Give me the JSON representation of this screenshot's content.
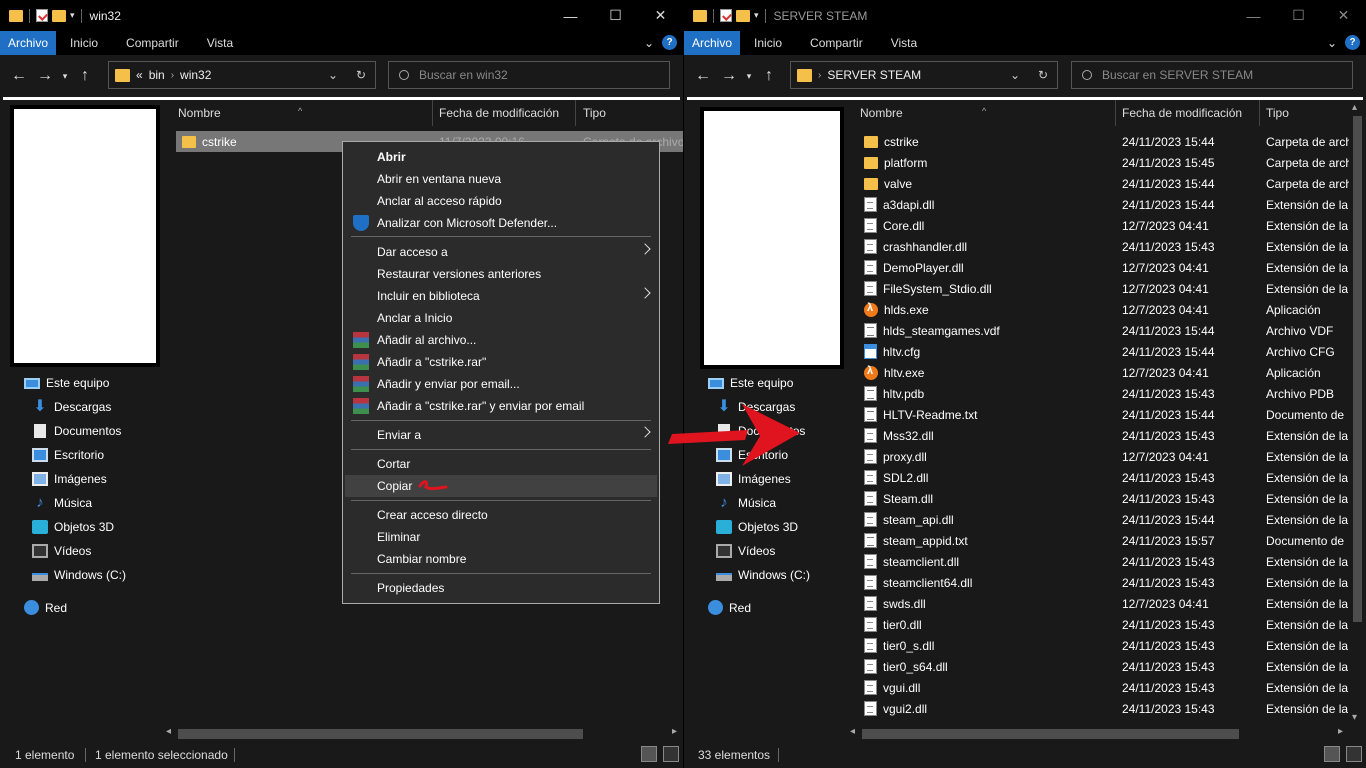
{
  "left": {
    "title": "win32",
    "ribbon_tabs": [
      "Archivo",
      "Inicio",
      "Compartir",
      "Vista"
    ],
    "breadcrumb": [
      "«",
      "bin",
      "win32"
    ],
    "search_placeholder": "Buscar en win32",
    "nav_items": [
      "Este equipo",
      "Descargas",
      "Documentos",
      "Escritorio",
      "Imágenes",
      "Música",
      "Objetos 3D",
      "Vídeos",
      "Windows (C:)",
      "Red"
    ],
    "columns": [
      "Nombre",
      "Fecha de modificación",
      "Tipo"
    ],
    "row": {
      "name": "cstrike",
      "date": "11/7/2023 00:16",
      "type": "Carpeta de archivos"
    },
    "status_count": "1 elemento",
    "status_selected": "1 elemento seleccionado"
  },
  "context_menu": {
    "items": [
      "Abrir",
      "Abrir en ventana nueva",
      "Anclar al acceso rápido",
      "Analizar con Microsoft Defender...",
      "Dar acceso a",
      "Restaurar versiones anteriores",
      "Incluir en biblioteca",
      "Anclar a Inicio",
      "Añadir al archivo...",
      "Añadir a \"cstrike.rar\"",
      "Añadir y enviar por email...",
      "Añadir a \"cstrike.rar\" y enviar por email",
      "Enviar a",
      "Cortar",
      "Copiar",
      "Crear acceso directo",
      "Eliminar",
      "Cambiar nombre",
      "Propiedades"
    ],
    "highlighted": "Copiar"
  },
  "right": {
    "title": "SERVER STEAM",
    "ribbon_tabs": [
      "Archivo",
      "Inicio",
      "Compartir",
      "Vista"
    ],
    "breadcrumb": [
      "SERVER STEAM"
    ],
    "search_placeholder": "Buscar en SERVER STEAM",
    "nav_items": [
      "Este equipo",
      "Descargas",
      "Documentos",
      "Escritorio",
      "Imágenes",
      "Música",
      "Objetos 3D",
      "Vídeos",
      "Windows (C:)",
      "Red"
    ],
    "columns": [
      "Nombre",
      "Fecha de modificación",
      "Tipo"
    ],
    "rows": [
      {
        "name": "cstrike",
        "date": "24/11/2023 15:44",
        "type": "Carpeta de arch",
        "icon": "folder"
      },
      {
        "name": "platform",
        "date": "24/11/2023 15:45",
        "type": "Carpeta de arch",
        "icon": "folder"
      },
      {
        "name": "valve",
        "date": "24/11/2023 15:44",
        "type": "Carpeta de arch",
        "icon": "folder"
      },
      {
        "name": "a3dapi.dll",
        "date": "24/11/2023 15:44",
        "type": "Extensión de la",
        "icon": "dll"
      },
      {
        "name": "Core.dll",
        "date": "12/7/2023 04:41",
        "type": "Extensión de la",
        "icon": "dll"
      },
      {
        "name": "crashhandler.dll",
        "date": "24/11/2023 15:43",
        "type": "Extensión de la",
        "icon": "dll"
      },
      {
        "name": "DemoPlayer.dll",
        "date": "12/7/2023 04:41",
        "type": "Extensión de la",
        "icon": "dll"
      },
      {
        "name": "FileSystem_Stdio.dll",
        "date": "12/7/2023 04:41",
        "type": "Extensión de la",
        "icon": "dll"
      },
      {
        "name": "hlds.exe",
        "date": "12/7/2023 04:41",
        "type": "Aplicación",
        "icon": "exe"
      },
      {
        "name": "hlds_steamgames.vdf",
        "date": "24/11/2023 15:44",
        "type": "Archivo VDF",
        "icon": "txt"
      },
      {
        "name": "hltv.cfg",
        "date": "24/11/2023 15:44",
        "type": "Archivo CFG",
        "icon": "cfg"
      },
      {
        "name": "hltv.exe",
        "date": "12/7/2023 04:41",
        "type": "Aplicación",
        "icon": "exe"
      },
      {
        "name": "hltv.pdb",
        "date": "24/11/2023 15:43",
        "type": "Archivo PDB",
        "icon": "txt"
      },
      {
        "name": "HLTV-Readme.txt",
        "date": "24/11/2023 15:44",
        "type": "Documento de",
        "icon": "txt"
      },
      {
        "name": "Mss32.dll",
        "date": "24/11/2023 15:43",
        "type": "Extensión de la",
        "icon": "dll"
      },
      {
        "name": "proxy.dll",
        "date": "12/7/2023 04:41",
        "type": "Extensión de la",
        "icon": "dll"
      },
      {
        "name": "SDL2.dll",
        "date": "24/11/2023 15:43",
        "type": "Extensión de la",
        "icon": "dll"
      },
      {
        "name": "Steam.dll",
        "date": "24/11/2023 15:43",
        "type": "Extensión de la",
        "icon": "dll"
      },
      {
        "name": "steam_api.dll",
        "date": "24/11/2023 15:44",
        "type": "Extensión de la",
        "icon": "dll"
      },
      {
        "name": "steam_appid.txt",
        "date": "24/11/2023 15:57",
        "type": "Documento de",
        "icon": "txt"
      },
      {
        "name": "steamclient.dll",
        "date": "24/11/2023 15:43",
        "type": "Extensión de la",
        "icon": "dll"
      },
      {
        "name": "steamclient64.dll",
        "date": "24/11/2023 15:43",
        "type": "Extensión de la",
        "icon": "dll"
      },
      {
        "name": "swds.dll",
        "date": "12/7/2023 04:41",
        "type": "Extensión de la",
        "icon": "dll"
      },
      {
        "name": "tier0.dll",
        "date": "24/11/2023 15:43",
        "type": "Extensión de la",
        "icon": "dll"
      },
      {
        "name": "tier0_s.dll",
        "date": "24/11/2023 15:43",
        "type": "Extensión de la",
        "icon": "dll"
      },
      {
        "name": "tier0_s64.dll",
        "date": "24/11/2023 15:43",
        "type": "Extensión de la",
        "icon": "dll"
      },
      {
        "name": "vgui.dll",
        "date": "24/11/2023 15:43",
        "type": "Extensión de la",
        "icon": "dll"
      },
      {
        "name": "vgui2.dll",
        "date": "24/11/2023 15:43",
        "type": "Extensión de la",
        "icon": "dll"
      }
    ],
    "status_count": "33 elementos"
  },
  "annotation_color": "#e0141e"
}
